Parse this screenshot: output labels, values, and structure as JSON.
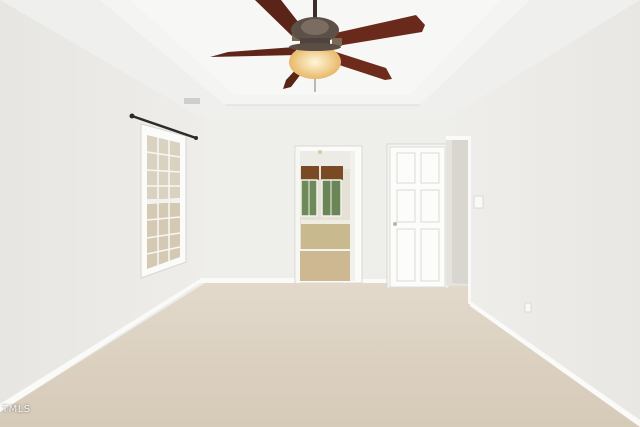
{
  "scene": {
    "watermark": "TMLS",
    "colors": {
      "wall": "#ebeae6",
      "ceiling": "#f1f1ef",
      "carpet": "#d8cdbd",
      "trim": "#fbfbf9",
      "fan_blade": "#6b2a1c"
    }
  }
}
